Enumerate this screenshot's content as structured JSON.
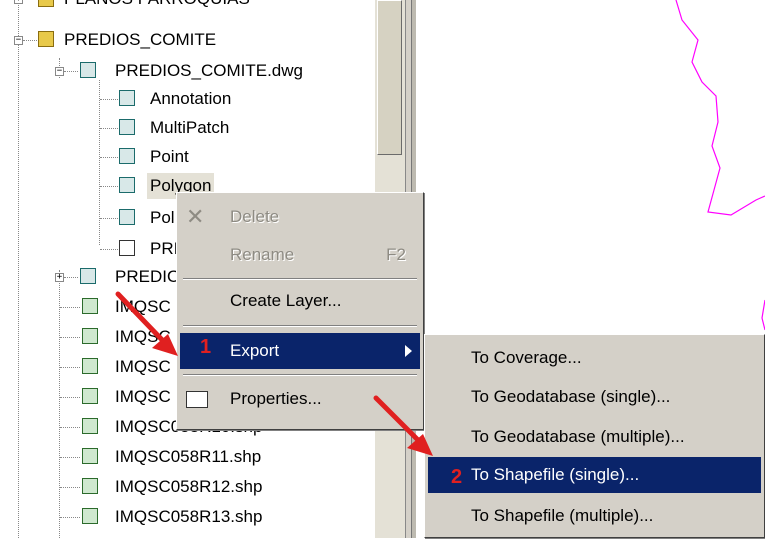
{
  "tree": {
    "top_cut_label": "PLANOS PARROQUIAS",
    "folder_label": "PREDIOS_COMITE",
    "dwg_label": "PREDIOS_COMITE.dwg",
    "children": [
      {
        "label": "Annotation",
        "icon": "annotation-icon"
      },
      {
        "label": "MultiPatch",
        "icon": "multipatch-icon"
      },
      {
        "label": "Point",
        "icon": "point-icon"
      },
      {
        "label": "Polygon",
        "icon": "polygon-icon"
      },
      {
        "label": "Pol",
        "icon": "polyline-icon"
      },
      {
        "label": "PRI",
        "icon": "dwg-layer-icon"
      }
    ],
    "dwg2_label": "PREDIO",
    "shapefiles": [
      "IMQSC",
      "IMQSC",
      "IMQSC",
      "IMQSC",
      "IMQSC058R10.shp",
      "IMQSC058R11.shp",
      "IMQSC058R12.shp",
      "IMQSC058R13.shp"
    ]
  },
  "context_menu": {
    "delete": "Delete",
    "rename": "Rename",
    "rename_shortcut": "F2",
    "create_layer": "Create Layer...",
    "export": "Export",
    "properties": "Properties..."
  },
  "submenu": {
    "to_coverage": "To Coverage...",
    "to_geodatabase_single": "To Geodatabase (single)...",
    "to_geodatabase_multiple": "To Geodatabase (multiple)...",
    "to_shapefile_single": "To Shapefile (single)...",
    "to_shapefile_multiple": "To Shapefile (multiple)..."
  },
  "annotations": {
    "step1": "1",
    "step2": "2"
  },
  "colors": {
    "selection": "#0a246a",
    "map_line": "#ff00ff",
    "arrow": "#e02020"
  }
}
